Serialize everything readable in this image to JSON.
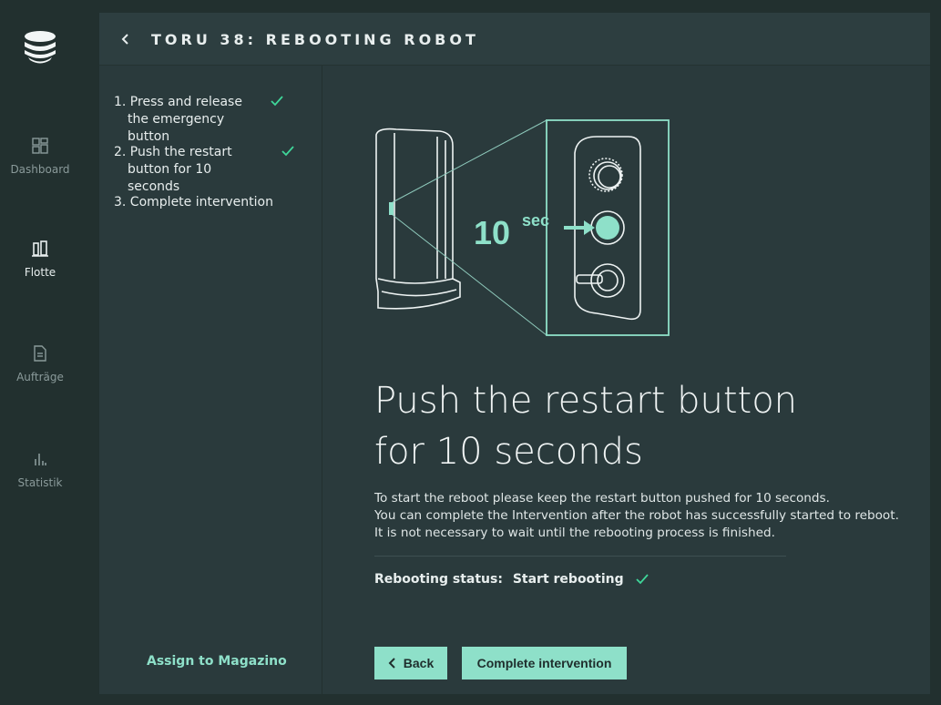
{
  "nav": {
    "items": [
      {
        "label": "Dashboard",
        "icon": "dashboard-icon"
      },
      {
        "label": "Flotte",
        "icon": "fleet-icon",
        "active": true
      },
      {
        "label": "Aufträge",
        "icon": "orders-icon"
      },
      {
        "label": "Statistik",
        "icon": "statistics-icon"
      }
    ]
  },
  "header": {
    "title": "TORU 38: REBOOTING ROBOT"
  },
  "steps": [
    {
      "label": "1. Press and release the emergency button",
      "done": true
    },
    {
      "label": "2. Push the restart button for 10 seconds",
      "done": true
    },
    {
      "label": "3. Complete intervention",
      "done": false
    }
  ],
  "assign_label": "Assign to Magazino",
  "illustration": {
    "seconds": "10",
    "unit": "sec"
  },
  "main": {
    "headline_line1": "Push the restart button",
    "headline_line2": "for 10 seconds",
    "body_line1": "To start the reboot please keep the restart button pushed for 10 seconds.",
    "body_line2": "You can complete the Intervention after the robot has successfully started to reboot.",
    "body_line3": "It is not necessary to wait until the rebooting process is finished.",
    "status_label": "Rebooting status:",
    "status_value": "Start rebooting"
  },
  "buttons": {
    "back": "Back",
    "complete": "Complete intervention"
  },
  "colors": {
    "accent": "#8ee0c9",
    "check": "#3fd79a",
    "panel": "#2a3a3c",
    "background": "#22302f"
  }
}
